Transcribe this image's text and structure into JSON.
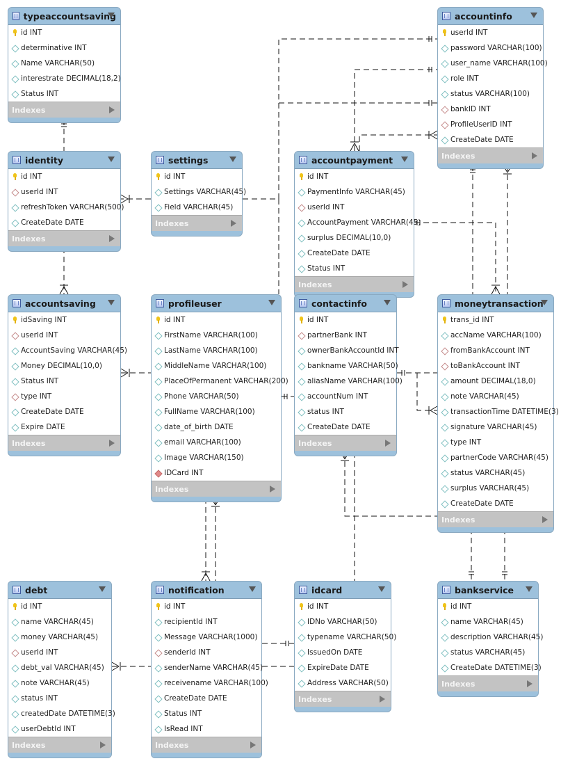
{
  "indexes_label": "Indexes",
  "colors": {
    "header": "#9dc1dc",
    "indexes": "#c3c3c3",
    "pk_icon": "#f0c419",
    "column_icon": "#7fbfc0",
    "fk_icon": "#c48a8a"
  },
  "tables": [
    {
      "name": "typeaccountsaving",
      "columns": [
        {
          "text": "id INT",
          "kind": "pk"
        },
        {
          "text": "determinative INT",
          "kind": "col"
        },
        {
          "text": "Name VARCHAR(50)",
          "kind": "col"
        },
        {
          "text": "interestrate DECIMAL(18,2)",
          "kind": "col"
        },
        {
          "text": "Status INT",
          "kind": "col"
        }
      ]
    },
    {
      "name": "identity",
      "columns": [
        {
          "text": "id INT",
          "kind": "pk"
        },
        {
          "text": "userId INT",
          "kind": "fk"
        },
        {
          "text": "refreshToken VARCHAR(500)",
          "kind": "col"
        },
        {
          "text": "CreateDate DATE",
          "kind": "col"
        }
      ]
    },
    {
      "name": "settings",
      "columns": [
        {
          "text": "id INT",
          "kind": "pk"
        },
        {
          "text": "Settings VARCHAR(45)",
          "kind": "col"
        },
        {
          "text": "Field VARCHAR(45)",
          "kind": "col"
        }
      ]
    },
    {
      "name": "accountpayment",
      "columns": [
        {
          "text": "id INT",
          "kind": "pk"
        },
        {
          "text": "PaymentInfo VARCHAR(45)",
          "kind": "col"
        },
        {
          "text": "userId INT",
          "kind": "fk"
        },
        {
          "text": "AccountPayment VARCHAR(45)",
          "kind": "col"
        },
        {
          "text": "surplus DECIMAL(10,0)",
          "kind": "col"
        },
        {
          "text": "CreateDate DATE",
          "kind": "col"
        },
        {
          "text": "Status INT",
          "kind": "col"
        }
      ]
    },
    {
      "name": "accountinfo",
      "columns": [
        {
          "text": "userId INT",
          "kind": "pk"
        },
        {
          "text": "password VARCHAR(100)",
          "kind": "col"
        },
        {
          "text": "user_name VARCHAR(100)",
          "kind": "col"
        },
        {
          "text": "role INT",
          "kind": "col"
        },
        {
          "text": "status VARCHAR(100)",
          "kind": "col"
        },
        {
          "text": "bankID INT",
          "kind": "fk"
        },
        {
          "text": "ProfileUserID INT",
          "kind": "fk"
        },
        {
          "text": "CreateDate DATE",
          "kind": "col"
        }
      ]
    },
    {
      "name": "accountsaving",
      "columns": [
        {
          "text": "idSaving INT",
          "kind": "pk"
        },
        {
          "text": "userId INT",
          "kind": "fk"
        },
        {
          "text": "AccountSaving VARCHAR(45)",
          "kind": "col"
        },
        {
          "text": "Money DECIMAL(10,0)",
          "kind": "col"
        },
        {
          "text": "Status INT",
          "kind": "col"
        },
        {
          "text": "type INT",
          "kind": "fk"
        },
        {
          "text": "CreateDate DATE",
          "kind": "col"
        },
        {
          "text": "Expire DATE",
          "kind": "col"
        }
      ]
    },
    {
      "name": "profileuser",
      "columns": [
        {
          "text": "id INT",
          "kind": "pk"
        },
        {
          "text": "FirstName VARCHAR(100)",
          "kind": "col"
        },
        {
          "text": "LastName VARCHAR(100)",
          "kind": "col"
        },
        {
          "text": "MiddleName VARCHAR(100)",
          "kind": "col"
        },
        {
          "text": "PlaceOfPermanent VARCHAR(200)",
          "kind": "col"
        },
        {
          "text": "Phone VARCHAR(50)",
          "kind": "col"
        },
        {
          "text": "FullName VARCHAR(100)",
          "kind": "col"
        },
        {
          "text": "date_of_birth DATE",
          "kind": "col"
        },
        {
          "text": "email VARCHAR(100)",
          "kind": "col"
        },
        {
          "text": "Image VARCHAR(150)",
          "kind": "col"
        },
        {
          "text": "IDCard INT",
          "kind": "fkf"
        }
      ]
    },
    {
      "name": "contactinfo",
      "columns": [
        {
          "text": "id INT",
          "kind": "pk"
        },
        {
          "text": "partnerBank INT",
          "kind": "fk"
        },
        {
          "text": "ownerBankAccountId INT",
          "kind": "col"
        },
        {
          "text": "bankname VARCHAR(50)",
          "kind": "col"
        },
        {
          "text": "aliasName VARCHAR(100)",
          "kind": "col"
        },
        {
          "text": "accountNum INT",
          "kind": "col"
        },
        {
          "text": "status INT",
          "kind": "col"
        },
        {
          "text": "CreateDate DATE",
          "kind": "col"
        }
      ]
    },
    {
      "name": "moneytransaction",
      "columns": [
        {
          "text": "trans_id INT",
          "kind": "pk"
        },
        {
          "text": "accName VARCHAR(100)",
          "kind": "col"
        },
        {
          "text": "fromBankAccount INT",
          "kind": "fk"
        },
        {
          "text": "toBankAccount INT",
          "kind": "fk"
        },
        {
          "text": "amount DECIMAL(18,0)",
          "kind": "col"
        },
        {
          "text": "note VARCHAR(45)",
          "kind": "col"
        },
        {
          "text": "transactionTime DATETIME(3)",
          "kind": "col"
        },
        {
          "text": "signature VARCHAR(45)",
          "kind": "col"
        },
        {
          "text": "type INT",
          "kind": "col"
        },
        {
          "text": "partnerCode VARCHAR(45)",
          "kind": "col"
        },
        {
          "text": "status VARCHAR(45)",
          "kind": "col"
        },
        {
          "text": "surplus VARCHAR(45)",
          "kind": "col"
        },
        {
          "text": "CreateDate DATE",
          "kind": "col"
        }
      ]
    },
    {
      "name": "debt",
      "columns": [
        {
          "text": "id INT",
          "kind": "pk"
        },
        {
          "text": "name VARCHAR(45)",
          "kind": "col"
        },
        {
          "text": "money VARCHAR(45)",
          "kind": "col"
        },
        {
          "text": "userId INT",
          "kind": "fk"
        },
        {
          "text": "debt_val VARCHAR(45)",
          "kind": "col"
        },
        {
          "text": "note VARCHAR(45)",
          "kind": "col"
        },
        {
          "text": "status INT",
          "kind": "col"
        },
        {
          "text": "createdDate DATETIME(3)",
          "kind": "col"
        },
        {
          "text": "userDebtId INT",
          "kind": "col"
        }
      ]
    },
    {
      "name": "notification",
      "columns": [
        {
          "text": "id INT",
          "kind": "pk"
        },
        {
          "text": "recipientId INT",
          "kind": "col"
        },
        {
          "text": "Message VARCHAR(1000)",
          "kind": "col"
        },
        {
          "text": "senderId INT",
          "kind": "fk"
        },
        {
          "text": "senderName VARCHAR(45)",
          "kind": "col"
        },
        {
          "text": "receivename VARCHAR(100)",
          "kind": "col"
        },
        {
          "text": "CreateDate DATE",
          "kind": "col"
        },
        {
          "text": "Status INT",
          "kind": "col"
        },
        {
          "text": "IsRead INT",
          "kind": "col"
        }
      ]
    },
    {
      "name": "idcard",
      "columns": [
        {
          "text": "id INT",
          "kind": "pk"
        },
        {
          "text": "IDNo VARCHAR(50)",
          "kind": "col"
        },
        {
          "text": "typename VARCHAR(50)",
          "kind": "col"
        },
        {
          "text": "IssuedOn DATE",
          "kind": "col"
        },
        {
          "text": "ExpireDate DATE",
          "kind": "col"
        },
        {
          "text": "Address VARCHAR(50)",
          "kind": "col"
        }
      ]
    },
    {
      "name": "bankservice",
      "columns": [
        {
          "text": "id INT",
          "kind": "pk"
        },
        {
          "text": "name VARCHAR(45)",
          "kind": "col"
        },
        {
          "text": "description VARCHAR(45)",
          "kind": "col"
        },
        {
          "text": "status VARCHAR(45)",
          "kind": "col"
        },
        {
          "text": "CreateDate DATETIME(3)",
          "kind": "col"
        }
      ]
    }
  ]
}
